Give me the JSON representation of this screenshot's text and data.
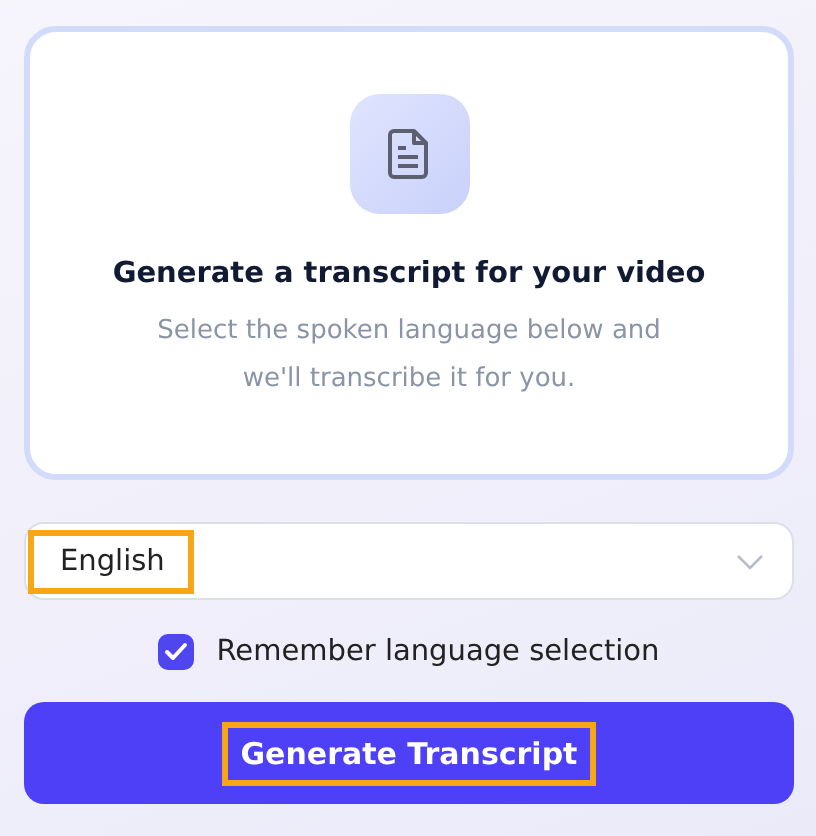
{
  "card": {
    "title": "Generate a transcript for your video",
    "description": "Select the spoken language below and we'll transcribe it for you."
  },
  "language_select": {
    "value": "English",
    "highlighted": true
  },
  "remember_checkbox": {
    "label": "Remember language selection",
    "checked": true
  },
  "generate_button": {
    "label": "Generate Transcript",
    "highlighted": true
  }
}
